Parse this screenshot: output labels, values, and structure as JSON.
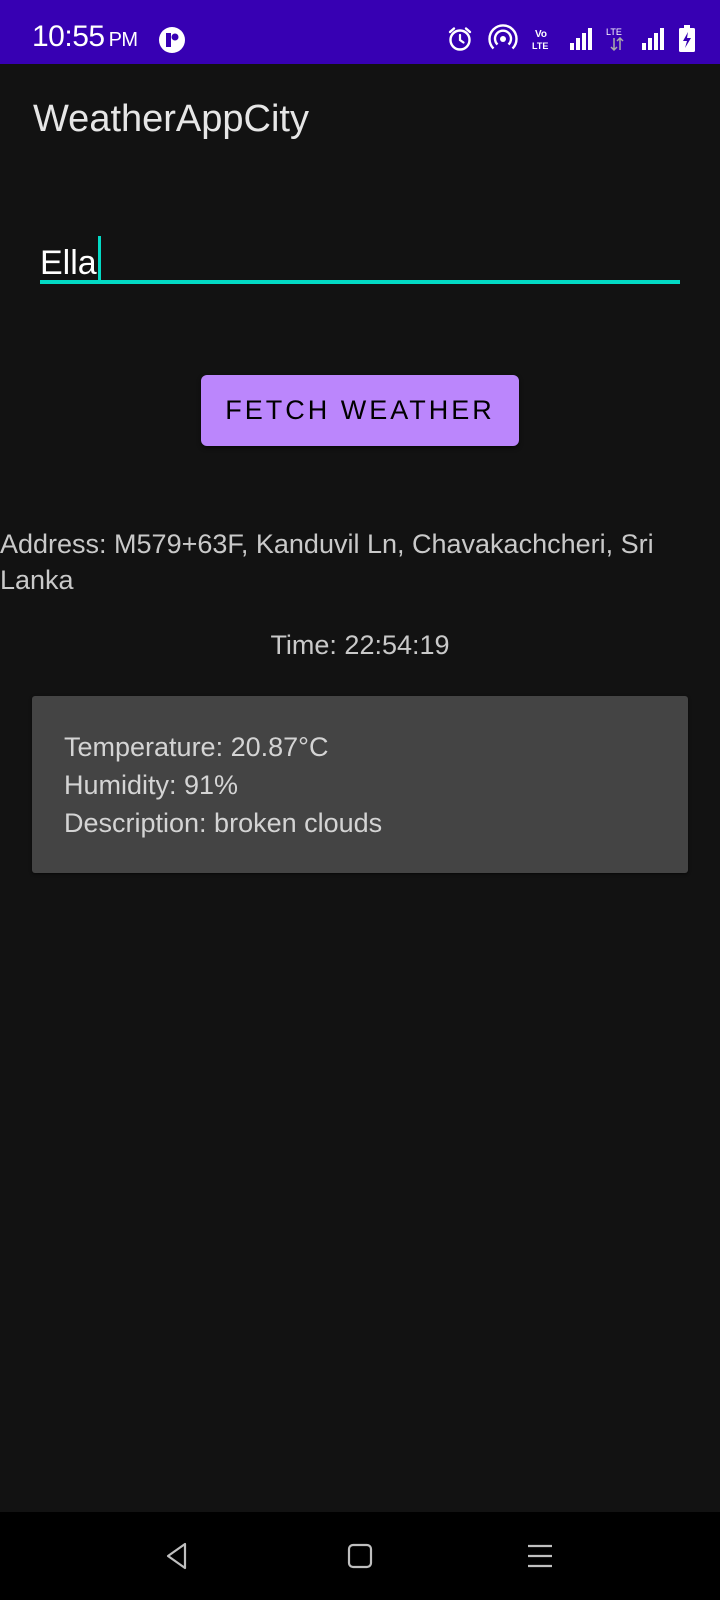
{
  "status_bar": {
    "time": "10:55",
    "ampm": "PM",
    "background": "#3700B3",
    "icons": [
      "app-notification-icon",
      "alarm-icon",
      "hotspot-icon",
      "volte-icon",
      "signal-icon",
      "lte-signal-icon",
      "signal-icon",
      "battery-charging-icon"
    ],
    "volte_label_top": "Vo",
    "volte_label_bottom": "LTE",
    "lte_label": "LTE"
  },
  "app_bar": {
    "title": "WeatherAppCity"
  },
  "city_input": {
    "value": "Ella",
    "accent": "#03DAC5"
  },
  "fetch_button": {
    "label": "FETCH WEATHER",
    "color": "#BB86FC"
  },
  "address": "Address: M579+63F, Kanduvil Ln, Chavakachcheri, Sri Lanka",
  "time": "Time: 22:54:19",
  "weather": {
    "temperature": "Temperature: 20.87°C",
    "humidity": "Humidity: 91%",
    "description": "Description: broken clouds"
  },
  "nav_bar": {
    "buttons": [
      "back-icon",
      "home-icon",
      "recents-icon"
    ]
  }
}
